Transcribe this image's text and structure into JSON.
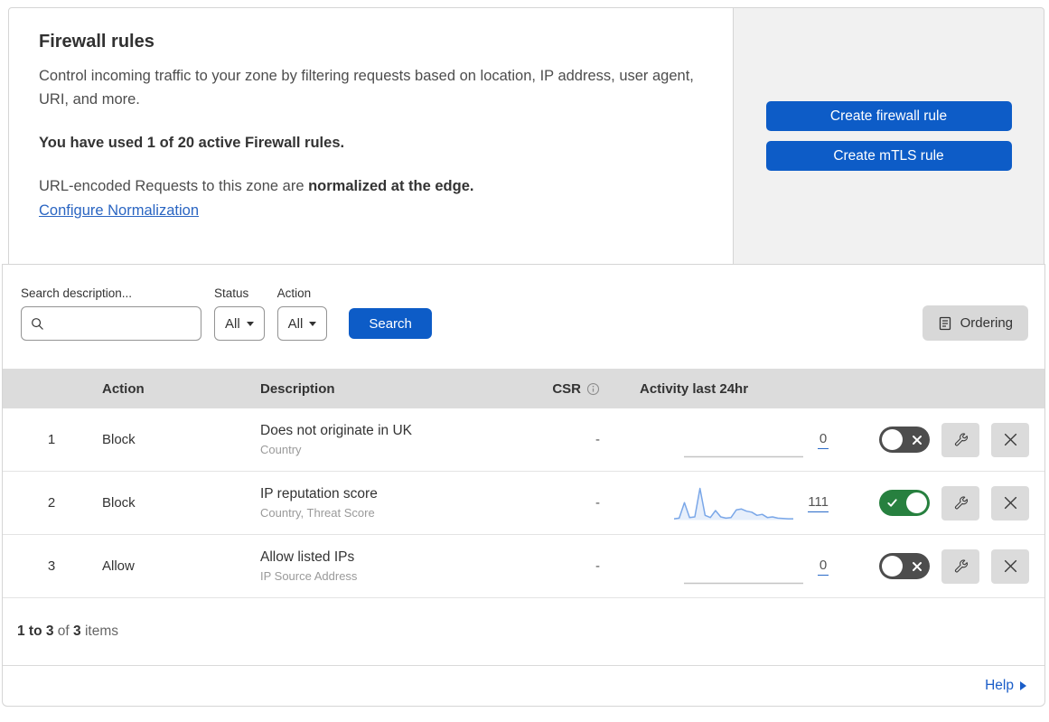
{
  "header": {
    "title": "Firewall rules",
    "description": "Control incoming traffic to your zone by filtering requests based on location, IP address, user agent, URI, and more.",
    "usage_note": "You have used 1 of 20 active Firewall rules.",
    "normalization_prefix": "URL-encoded Requests to this zone are ",
    "normalization_bold": "normalized at the edge.",
    "normalization_link": "Configure Normalization"
  },
  "actions_panel": {
    "create_firewall_rule_label": "Create firewall rule",
    "create_mtls_rule_label": "Create mTLS rule"
  },
  "filter_bar": {
    "search_label": "Search description...",
    "status_label": "Status",
    "status_value": "All",
    "action_label": "Action",
    "action_value": "All",
    "search_button_label": "Search",
    "ordering_button_label": "Ordering"
  },
  "table": {
    "columns": {
      "action": "Action",
      "description": "Description",
      "csr": "CSR",
      "activity": "Activity last 24hr"
    },
    "rows": [
      {
        "priority": "1",
        "action": "Block",
        "description": "Does not originate in UK",
        "match_fields": "Country",
        "csr": "-",
        "activity_count": "0",
        "enabled": false,
        "sparkline": [
          0,
          0,
          0,
          0,
          0,
          0,
          0,
          0,
          0,
          0,
          0,
          0,
          0,
          0,
          0,
          0,
          0,
          0,
          0,
          0,
          0,
          0,
          0,
          0
        ]
      },
      {
        "priority": "2",
        "action": "Block",
        "description": "IP reputation score",
        "match_fields": "Country, Threat Score",
        "csr": "-",
        "activity_count": "111",
        "enabled": true,
        "sparkline": [
          4,
          6,
          55,
          8,
          10,
          100,
          15,
          8,
          30,
          10,
          6,
          8,
          32,
          35,
          28,
          25,
          15,
          18,
          8,
          10,
          6,
          5,
          4,
          4
        ]
      },
      {
        "priority": "3",
        "action": "Allow",
        "description": "Allow listed IPs",
        "match_fields": "IP Source Address",
        "csr": "-",
        "activity_count": "0",
        "enabled": false,
        "sparkline": [
          0,
          0,
          0,
          0,
          0,
          0,
          0,
          0,
          0,
          0,
          0,
          0,
          0,
          0,
          0,
          0,
          0,
          0,
          0,
          0,
          0,
          0,
          0,
          0
        ]
      }
    ]
  },
  "footer": {
    "range_bold": "1 to 3",
    "of_text": " of ",
    "total_bold": "3",
    "items_text": " items"
  },
  "help": {
    "label": "Help"
  },
  "colors": {
    "accent_blue": "#0d5cc7",
    "link_blue": "#2a65c2",
    "toggle_on_green": "#27803f",
    "toggle_off_gray": "#4d4d4d",
    "sparkline_blue": "#7aa7e8",
    "sparkline_fill": "rgba(122,167,232,0.18)",
    "sparkline_flat_gray": "#c4c4c4",
    "table_header_bg": "#dcdcdc"
  }
}
